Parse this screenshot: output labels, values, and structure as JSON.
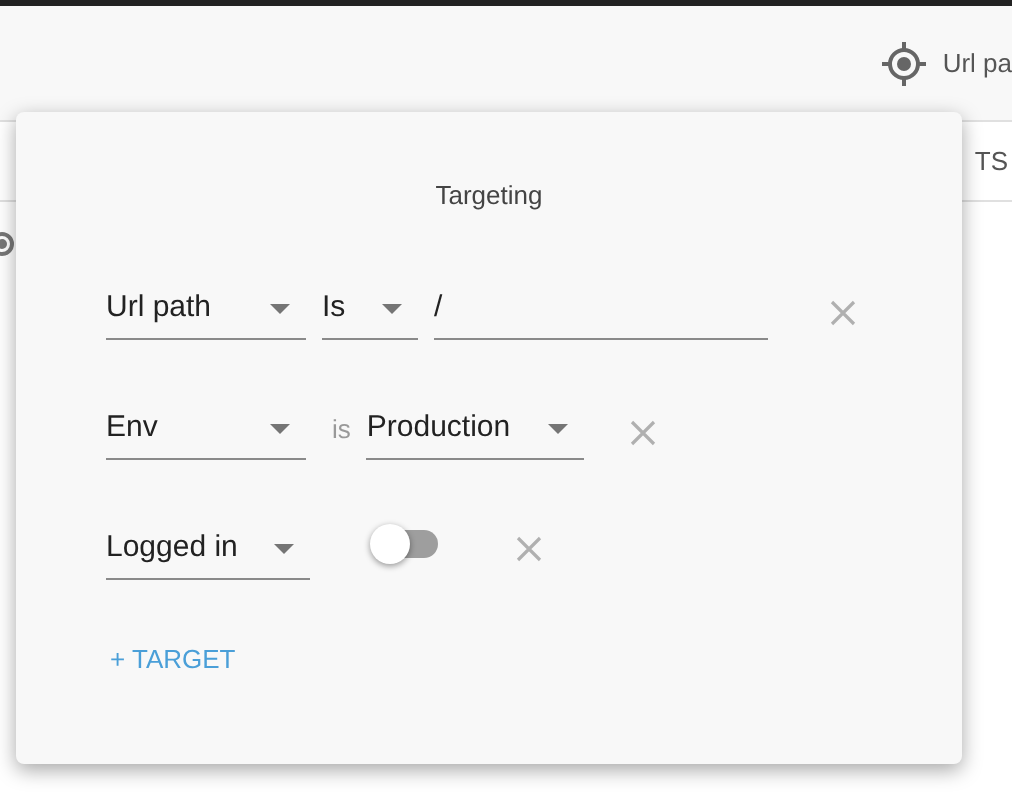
{
  "header": {
    "label": "Url pa"
  },
  "tabs": [
    {
      "label": "TS",
      "selected": false
    }
  ],
  "dialog": {
    "title": "Targeting",
    "targets": [
      {
        "kind": "text",
        "attribute": "Url path",
        "operator": "Is",
        "value": "/"
      },
      {
        "kind": "select",
        "attribute": "Env",
        "operator": "is",
        "value": "Production"
      },
      {
        "kind": "toggle",
        "attribute": "Logged in",
        "on": false
      }
    ],
    "add_button": "+ TARGET"
  }
}
